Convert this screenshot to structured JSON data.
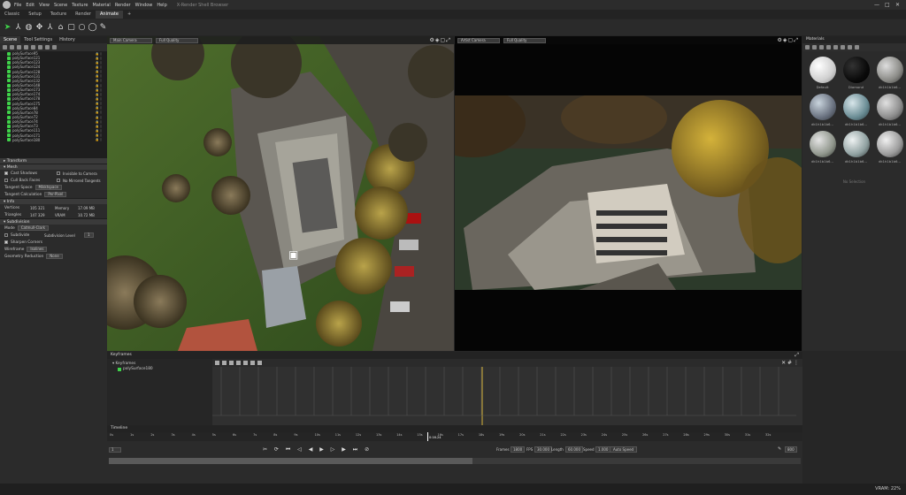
{
  "menubar": {
    "items": [
      "File",
      "Edit",
      "View",
      "Scene",
      "Texture",
      "Material",
      "Render",
      "Window",
      "Help"
    ],
    "app_title": "X-Render Shell Browser"
  },
  "window_controls": [
    "—",
    "□",
    "✕"
  ],
  "tabs": [
    "Classic",
    "Setup",
    "Texture",
    "Render",
    "Animate",
    "+"
  ],
  "active_tab": "Animate",
  "left_panel": {
    "tabs": [
      "Scene",
      "Tool Settings",
      "History"
    ],
    "scene_items": [
      "polySurface95",
      "polySurface121",
      "polySurface123",
      "polySurface124",
      "polySurface128",
      "polySurface131",
      "polySurface132",
      "polySurface148",
      "polySurface173",
      "polySurface174",
      "polySurface178",
      "polySurface175",
      "polySurface84",
      "polySurface78",
      "polySurface72",
      "polySurface74",
      "polySurface73",
      "polySurface111",
      "polySurface171",
      "polySurface180"
    ],
    "transform_label": "Transform",
    "mesh_label": "Mesh",
    "cast_shadows": "Cast Shadows",
    "invisible_to_camera": "Invisible to Camera",
    "cull_back_faces": "Cull Back Faces",
    "no_mirrored_tangents": "No Mirrored Tangents",
    "tangent_space": "Tangent Space",
    "tangent_space_val": "Mikktspace",
    "tangent_calc": "Tangent Calculation",
    "tangent_calc_val": "Per-Pixel",
    "info_label": "Info",
    "vertices_label": "Vertices",
    "vertices_val": "105 321",
    "triangles_label": "Triangles",
    "triangles_val": "147 329",
    "memory_label": "Memory",
    "memory_val": "17.09 MB",
    "vram_label": "VRAM",
    "vram_val": "10.72 MB",
    "subdivision_label": "Subdivision",
    "mode_label": "Mode",
    "mode_val": "Catmull-Clark",
    "subdivide_label": "Subdivide",
    "subdiv_level_label": "Subdivision Level",
    "subdiv_level_val": "1",
    "sharpen_corners": "Sharpen Corners",
    "wireframe_label": "Wireframe",
    "wireframe_val": "Isolines",
    "geom_reduction_label": "Geometry Reduction",
    "geom_reduction_val": "None"
  },
  "viewport_left": {
    "camera": "Main Camera",
    "quality": "Full Quality"
  },
  "viewport_right": {
    "camera": "Artist Camera",
    "quality": "Full Quality"
  },
  "materials": {
    "title": "Materials",
    "items": [
      "Default",
      "Diamond",
      "dk1h1b1b6...",
      "dk1h1b1b6...",
      "dk1h1b1b6...",
      "dk1h1b1b6...",
      "dk1h1b1b6...",
      "dk1h1b1b6...",
      "dk1h1b1b6..."
    ],
    "no_selection": "No Selection"
  },
  "keyframes": {
    "title": "Keyframes",
    "root": "Keyframes",
    "child": "polySurface180"
  },
  "timeline": {
    "title": "Timeline",
    "ticks": [
      "0s",
      "1s",
      "2s",
      "3s",
      "4s",
      "5s",
      "6s",
      "7s",
      "8s",
      "9s",
      "10s",
      "11s",
      "12s",
      "13s",
      "14s",
      "15s",
      "16s",
      "17s",
      "18s",
      "19s",
      "20s",
      "21s",
      "22s",
      "23s",
      "24s",
      "25s",
      "26s",
      "27s",
      "28s",
      "29s",
      "30s",
      "31s",
      "32s"
    ],
    "current_time": "0:16.24",
    "frame_field": "1",
    "frames_label": "Frames",
    "frames_val": "1800",
    "fps_label": "FPS",
    "fps_val": "30.000",
    "length_label": "Length",
    "length_val": "60.000",
    "speed_label": "Speed",
    "speed_val": "1.000",
    "auto_speed": "Auto Speed",
    "zoom_val": "800",
    "playhead_fraction": 0.5
  },
  "status": {
    "vram": "VRAM: 22%"
  }
}
